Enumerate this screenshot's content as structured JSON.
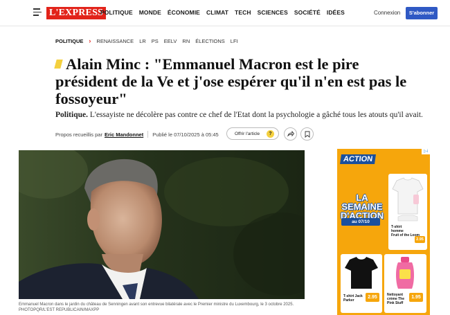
{
  "header": {
    "logo_text": "L'EXPRESS",
    "nav": [
      "POLITIQUE",
      "MONDE",
      "ÉCONOMIE",
      "CLIMAT",
      "TECH",
      "SCIENCES",
      "SOCIÉTÉ",
      "IDÉES"
    ],
    "login_label": "Connexion",
    "subscribe_label": "S'abonner"
  },
  "breadcrumb": {
    "section": "POLITIQUE",
    "tags": [
      "RENAISSANCE",
      "LR",
      "PS",
      "EELV",
      "RN",
      "ÉLECTIONS",
      "LFI"
    ]
  },
  "article": {
    "title": "Alain Minc : \"Emmanuel Macron est le pire président de la Ve et j'ose espérer qu'il n'en est pas le fossoyeur\"",
    "lede_kicker": "Politique.",
    "lede_text": " L'essayiste ne décolère pas contre ce chef de l'Etat dont la psychologie a gâché tous les atouts qu'il avait.",
    "byline_prefix": "Propos recueillis par",
    "author": "Eric Mandonnet",
    "published": "Publié le 07/10/2025 à 05:45",
    "offer_label": "Offrir l'article",
    "offer_badge": "?",
    "caption": "Emmanuel Macron dans le jardin du château de Senningen avant son entrevue bilatérale avec le Premier ministre du Luxembourg, le 3 octobre 2025.",
    "caption_credit": "PHOTOPQR/L'EST REPUBLICAIN/MAXPP"
  },
  "ad": {
    "flag": "▷i",
    "brand": "ACTION",
    "headline_1": "LA SEMAINE",
    "headline_2": "D'ACTION",
    "date": "au 07/10",
    "product_1_label_1": "T-shirt",
    "product_1_label_2": "homme",
    "product_1_label_3": "Fruit of the Loom",
    "product_1_price": "2.95",
    "product_2_label_1": "T-shirt Jack",
    "product_2_label_2": "Parker",
    "product_2_price": "2.95",
    "product_3_label_1": "Nettoyant",
    "product_3_label_2": "crème The",
    "product_3_label_3": "Pink Stuff",
    "product_3_price": "1.95"
  },
  "colors": {
    "brand_red": "#e2231a",
    "accent_yellow": "#f4d03f",
    "subscribe_blue": "#2f59c4",
    "ad_orange": "#f6a60c",
    "ad_blue": "#1a4f9c"
  }
}
